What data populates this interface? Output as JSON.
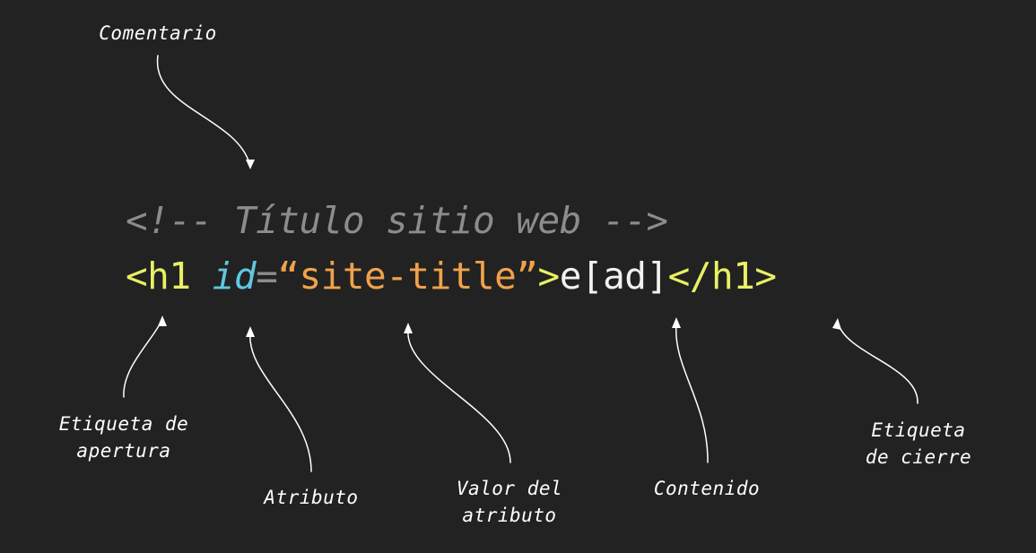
{
  "code": {
    "comment": "<!-- Título sitio web -->",
    "open_tag": "<h1",
    "attribute_name": "id",
    "equals": "=",
    "attribute_value": "“site-title”",
    "open_tag_end": ">",
    "content": "e[ad]",
    "close_tag": "</h1>"
  },
  "labels": {
    "comment": "Comentario",
    "opening_tag": "Etiqueta de\napertura",
    "attribute": "Atributo",
    "attribute_value": "Valor del\natributo",
    "content": "Contenido",
    "closing_tag": "Etiqueta\nde cierre"
  },
  "colors": {
    "background": "#222222",
    "tag": "#e9f064",
    "attribute_name": "#5ec8e0",
    "attribute_value": "#f0a24a",
    "comment": "#8c8c8c",
    "content": "#f2f2f2",
    "arrow": "#ffffff"
  }
}
